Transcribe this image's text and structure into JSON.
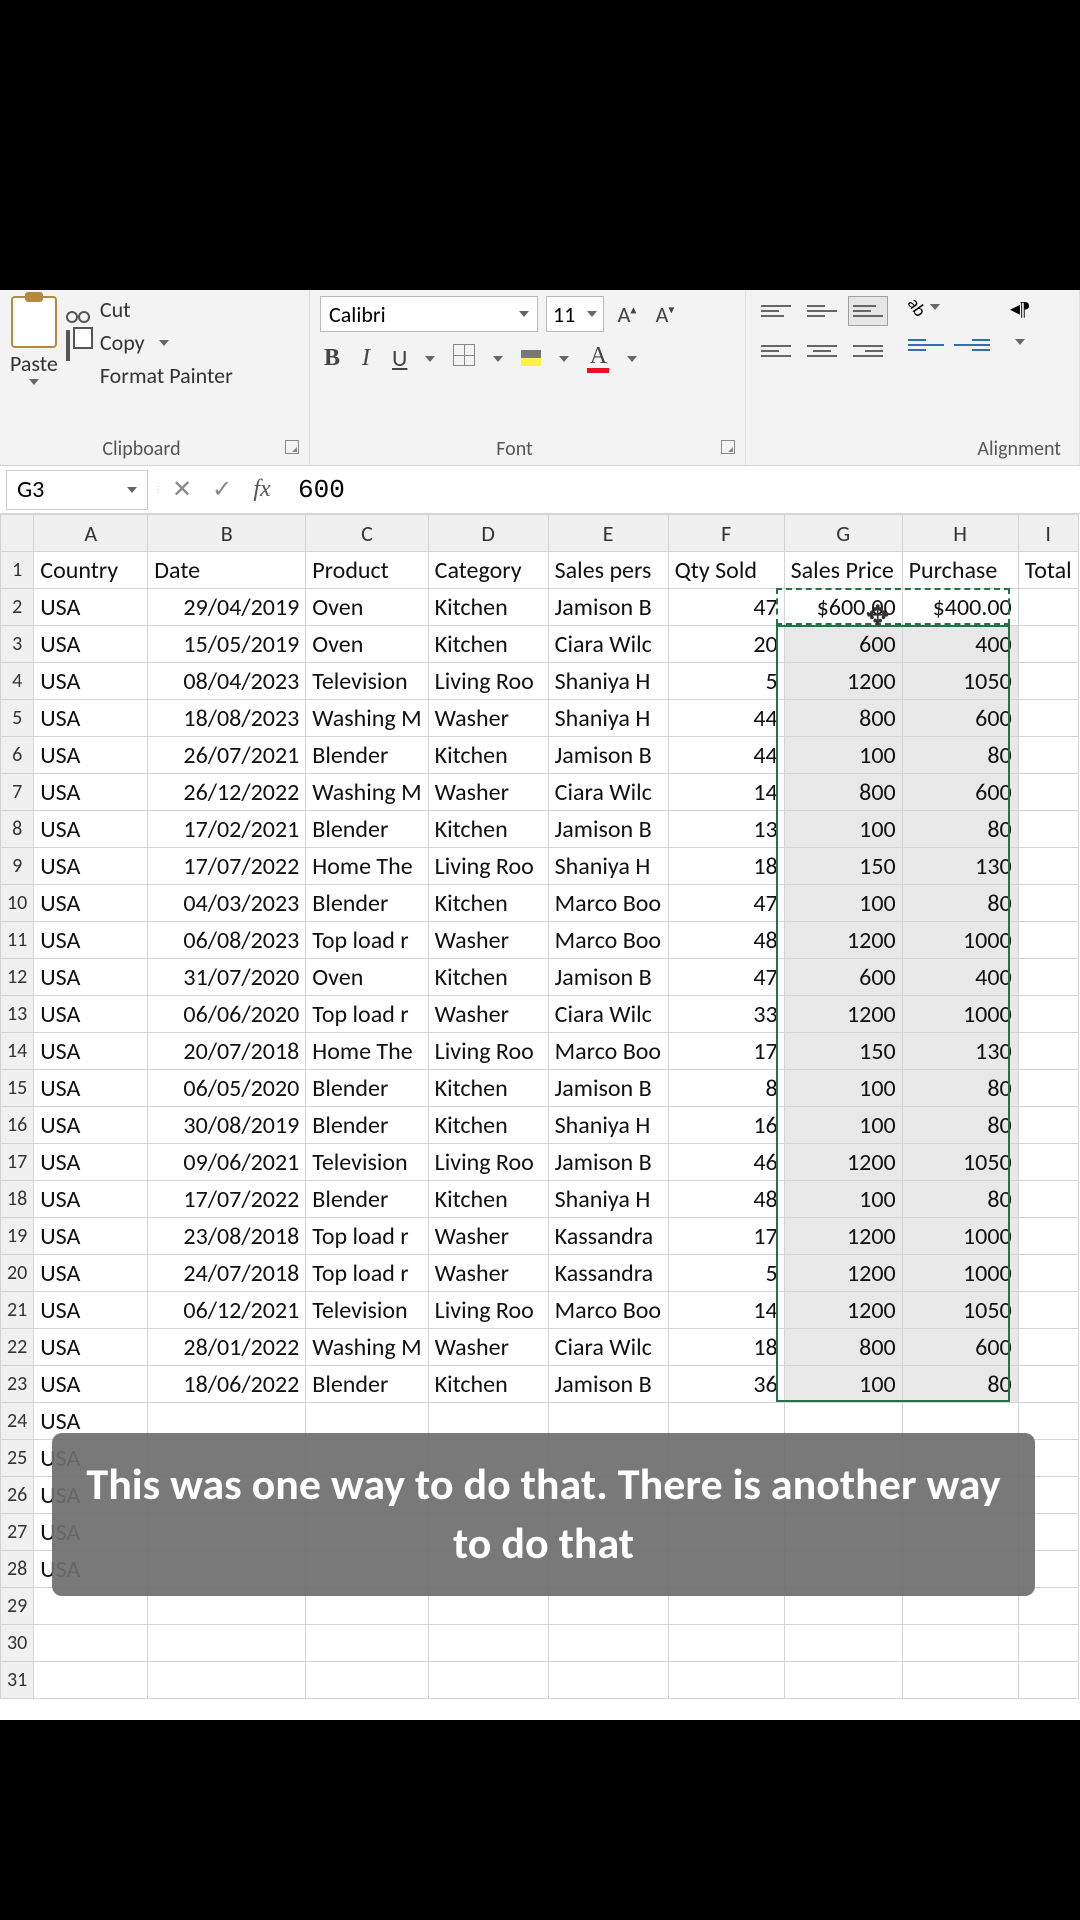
{
  "ribbon": {
    "cut": "Cut",
    "copy": "Copy",
    "format_painter": "Format Painter",
    "paste": "Paste",
    "grp_clipboard": "Clipboard",
    "grp_font": "Font",
    "grp_align": "Alignment",
    "font_name": "Calibri",
    "font_size": "11"
  },
  "formula": {
    "cell": "G3",
    "value": "600"
  },
  "columns": [
    "A",
    "B",
    "C",
    "D",
    "E",
    "F",
    "G",
    "H",
    "I"
  ],
  "headers": [
    "Country",
    "Date",
    "Product",
    "Category",
    "Sales pers",
    "Qty Sold",
    "Sales Price",
    "Purchase",
    "Total"
  ],
  "row2": {
    "g": "$600.00",
    "h": "$400.00"
  },
  "rows": [
    {
      "n": 2,
      "a": "USA",
      "b": "29/04/2019",
      "c": "Oven",
      "d": "Kitchen",
      "e": "Jamison B",
      "f": "47",
      "g": "$600.00",
      "h": "$400.00"
    },
    {
      "n": 3,
      "a": "USA",
      "b": "15/05/2019",
      "c": "Oven",
      "d": "Kitchen",
      "e": "Ciara Wilc",
      "f": "20",
      "g": "600",
      "h": "400"
    },
    {
      "n": 4,
      "a": "USA",
      "b": "08/04/2023",
      "c": "Television",
      "d": "Living Roo",
      "e": "Shaniya H",
      "f": "5",
      "g": "1200",
      "h": "1050"
    },
    {
      "n": 5,
      "a": "USA",
      "b": "18/08/2023",
      "c": "Washing M",
      "d": "Washer",
      "e": "Shaniya H",
      "f": "44",
      "g": "800",
      "h": "600"
    },
    {
      "n": 6,
      "a": "USA",
      "b": "26/07/2021",
      "c": "Blender",
      "d": "Kitchen",
      "e": "Jamison B",
      "f": "44",
      "g": "100",
      "h": "80"
    },
    {
      "n": 7,
      "a": "USA",
      "b": "26/12/2022",
      "c": "Washing M",
      "d": "Washer",
      "e": "Ciara Wilc",
      "f": "14",
      "g": "800",
      "h": "600"
    },
    {
      "n": 8,
      "a": "USA",
      "b": "17/02/2021",
      "c": "Blender",
      "d": "Kitchen",
      "e": "Jamison B",
      "f": "13",
      "g": "100",
      "h": "80"
    },
    {
      "n": 9,
      "a": "USA",
      "b": "17/07/2022",
      "c": "Home The",
      "d": "Living Roo",
      "e": "Shaniya H",
      "f": "18",
      "g": "150",
      "h": "130"
    },
    {
      "n": 10,
      "a": "USA",
      "b": "04/03/2023",
      "c": "Blender",
      "d": "Kitchen",
      "e": "Marco Boo",
      "f": "47",
      "g": "100",
      "h": "80"
    },
    {
      "n": 11,
      "a": "USA",
      "b": "06/08/2023",
      "c": "Top load r",
      "d": "Washer",
      "e": "Marco Boo",
      "f": "48",
      "g": "1200",
      "h": "1000"
    },
    {
      "n": 12,
      "a": "USA",
      "b": "31/07/2020",
      "c": "Oven",
      "d": "Kitchen",
      "e": "Jamison B",
      "f": "47",
      "g": "600",
      "h": "400"
    },
    {
      "n": 13,
      "a": "USA",
      "b": "06/06/2020",
      "c": "Top load r",
      "d": "Washer",
      "e": "Ciara Wilc",
      "f": "33",
      "g": "1200",
      "h": "1000"
    },
    {
      "n": 14,
      "a": "USA",
      "b": "20/07/2018",
      "c": "Home The",
      "d": "Living Roo",
      "e": "Marco Boo",
      "f": "17",
      "g": "150",
      "h": "130"
    },
    {
      "n": 15,
      "a": "USA",
      "b": "06/05/2020",
      "c": "Blender",
      "d": "Kitchen",
      "e": "Jamison B",
      "f": "8",
      "g": "100",
      "h": "80"
    },
    {
      "n": 16,
      "a": "USA",
      "b": "30/08/2019",
      "c": "Blender",
      "d": "Kitchen",
      "e": "Shaniya H",
      "f": "16",
      "g": "100",
      "h": "80"
    },
    {
      "n": 17,
      "a": "USA",
      "b": "09/06/2021",
      "c": "Television",
      "d": "Living Roo",
      "e": "Jamison B",
      "f": "46",
      "g": "1200",
      "h": "1050"
    },
    {
      "n": 18,
      "a": "USA",
      "b": "17/07/2022",
      "c": "Blender",
      "d": "Kitchen",
      "e": "Shaniya H",
      "f": "48",
      "g": "100",
      "h": "80"
    },
    {
      "n": 19,
      "a": "USA",
      "b": "23/08/2018",
      "c": "Top load r",
      "d": "Washer",
      "e": "Kassandra",
      "f": "17",
      "g": "1200",
      "h": "1000"
    },
    {
      "n": 20,
      "a": "USA",
      "b": "24/07/2018",
      "c": "Top load r",
      "d": "Washer",
      "e": "Kassandra",
      "f": "5",
      "g": "1200",
      "h": "1000"
    },
    {
      "n": 21,
      "a": "USA",
      "b": "06/12/2021",
      "c": "Television",
      "d": "Living Roo",
      "e": "Marco Boo",
      "f": "14",
      "g": "1200",
      "h": "1050"
    },
    {
      "n": 22,
      "a": "USA",
      "b": "28/01/2022",
      "c": "Washing M",
      "d": "Washer",
      "e": "Ciara Wilc",
      "f": "18",
      "g": "800",
      "h": "600"
    },
    {
      "n": 23,
      "a": "USA",
      "b": "18/06/2022",
      "c": "Blender",
      "d": "Kitchen",
      "e": "Jamison B",
      "f": "36",
      "g": "100",
      "h": "80"
    },
    {
      "n": 24,
      "a": "USA",
      "b": "",
      "c": "",
      "d": "",
      "e": "",
      "f": "",
      "g": "",
      "h": ""
    },
    {
      "n": 25,
      "a": "USA",
      "b": "",
      "c": "",
      "d": "",
      "e": "",
      "f": "",
      "g": "",
      "h": ""
    },
    {
      "n": 26,
      "a": "USA",
      "b": "",
      "c": "",
      "d": "",
      "e": "",
      "f": "",
      "g": "",
      "h": ""
    },
    {
      "n": 27,
      "a": "USA",
      "b": "",
      "c": "",
      "d": "",
      "e": "",
      "f": "",
      "g": "",
      "h": ""
    },
    {
      "n": 28,
      "a": "USA",
      "b": "",
      "c": "",
      "d": "",
      "e": "",
      "f": "",
      "g": "",
      "h": ""
    },
    {
      "n": 29,
      "a": "",
      "b": "",
      "c": "",
      "d": "",
      "e": "",
      "f": "",
      "g": "",
      "h": ""
    },
    {
      "n": 30,
      "a": "",
      "b": "",
      "c": "",
      "d": "",
      "e": "",
      "f": "",
      "g": "",
      "h": ""
    },
    {
      "n": 31,
      "a": "",
      "b": "",
      "c": "",
      "d": "",
      "e": "",
      "f": "",
      "g": "",
      "h": ""
    }
  ],
  "caption": "This was one way to do that. There is another way to do that"
}
